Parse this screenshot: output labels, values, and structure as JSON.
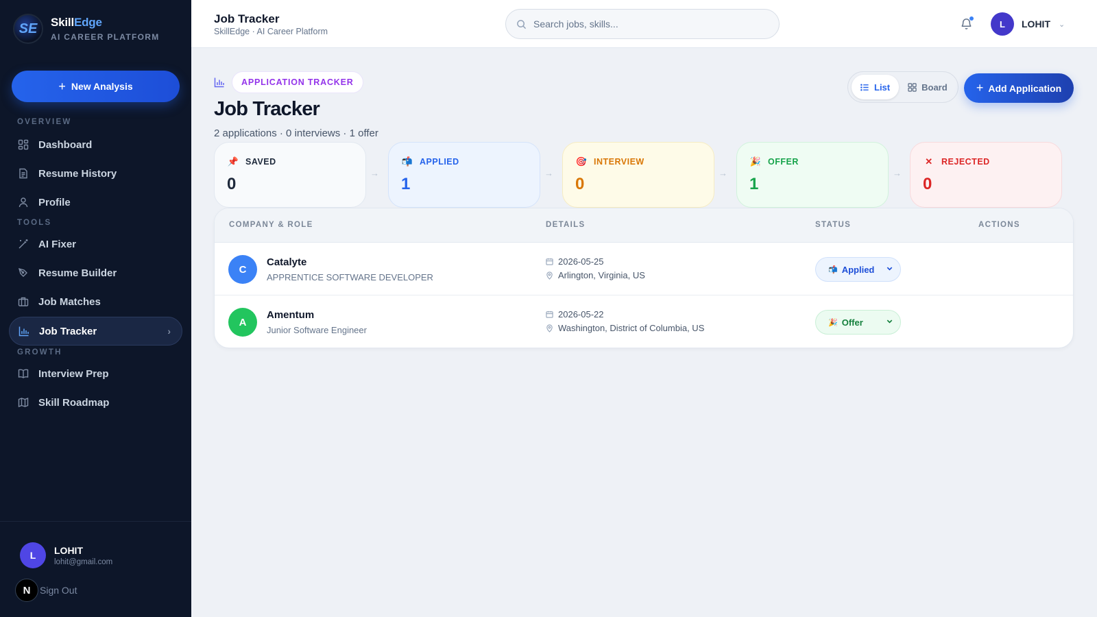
{
  "brand": {
    "name_part1": "Skill",
    "name_part2": "Edge",
    "tagline": "AI CAREER PLATFORM",
    "logo_text": "SE"
  },
  "sidebar": {
    "new_button": "New Analysis",
    "sections": {
      "overview": "OVERVIEW",
      "tools": "TOOLS",
      "growth": "GROWTH"
    },
    "items": [
      {
        "label": "Dashboard",
        "icon": "dashboard-icon"
      },
      {
        "label": "Resume History",
        "icon": "document-icon"
      },
      {
        "label": "Profile",
        "icon": "user-icon"
      },
      {
        "label": "AI Fixer",
        "icon": "magic-wand-icon"
      },
      {
        "label": "Resume Builder",
        "icon": "pen-tool-icon"
      },
      {
        "label": "Job Matches",
        "icon": "briefcase-icon"
      },
      {
        "label": "Job Tracker",
        "icon": "bar-chart-icon",
        "active": true
      },
      {
        "label": "Interview Prep",
        "icon": "book-icon"
      },
      {
        "label": "Skill Roadmap",
        "icon": "map-icon"
      }
    ],
    "user": {
      "initial": "L",
      "name": "LOHIT",
      "email": "lohit@gmail.com"
    },
    "signout_badge": "N",
    "signout": "Sign Out"
  },
  "header": {
    "title": "Job Tracker",
    "subtitle": "SkillEdge · AI Career Platform",
    "search_placeholder": "Search jobs, skills...",
    "user_initial": "L",
    "user_name": "LOHIT"
  },
  "page": {
    "eyebrow": "APPLICATION TRACKER",
    "title": "Job Tracker",
    "stats": "2 applications · 0 interviews · 1 offer",
    "view_list": "List",
    "view_board": "Board",
    "add_button": "Add Application"
  },
  "stages": [
    {
      "label": "SAVED",
      "count": "0",
      "icon": "pin-icon",
      "glyph": "📌",
      "color": "#1e293b",
      "bg": "#f8fafc",
      "border": "#e2e8f0"
    },
    {
      "label": "APPLIED",
      "count": "1",
      "icon": "mailbox-icon",
      "glyph": "📬",
      "color": "#2563eb",
      "bg": "#edf4fe",
      "border": "#d4e3fa"
    },
    {
      "label": "INTERVIEW",
      "count": "0",
      "icon": "target-icon",
      "glyph": "🎯",
      "color": "#d97706",
      "bg": "#fefbe8",
      "border": "#f6ecc2"
    },
    {
      "label": "OFFER",
      "count": "1",
      "icon": "party-icon",
      "glyph": "🎉",
      "color": "#16a34a",
      "bg": "#effcf3",
      "border": "#d1f2dc"
    },
    {
      "label": "REJECTED",
      "count": "0",
      "icon": "close-icon",
      "glyph": "✕",
      "color": "#dc2626",
      "bg": "#fdf1f2",
      "border": "#f8d9dc"
    }
  ],
  "table": {
    "headers": {
      "company": "COMPANY & ROLE",
      "details": "DETAILS",
      "status": "STATUS",
      "actions": "ACTIONS"
    },
    "rows": [
      {
        "initial": "C",
        "avatar_color": "#3b82f6",
        "company": "Catalyte",
        "role": "APPRENTICE SOFTWARE DEVELOPER",
        "date": "2026-05-25",
        "location": "Arlington, Virginia, US",
        "status": "Applied",
        "status_glyph": "📬",
        "status_color": "#1d4ed8",
        "status_bg": "#edf4fe",
        "status_border": "#cfe0fb"
      },
      {
        "initial": "A",
        "avatar_color": "#22c55e",
        "company": "Amentum",
        "role": "Junior Software Engineer",
        "date": "2026-05-22",
        "location": "Washington, District of Columbia, US",
        "status": "Offer",
        "status_glyph": "🎉",
        "status_color": "#15803d",
        "status_bg": "#ecfbf1",
        "status_border": "#c9efd6"
      }
    ]
  }
}
